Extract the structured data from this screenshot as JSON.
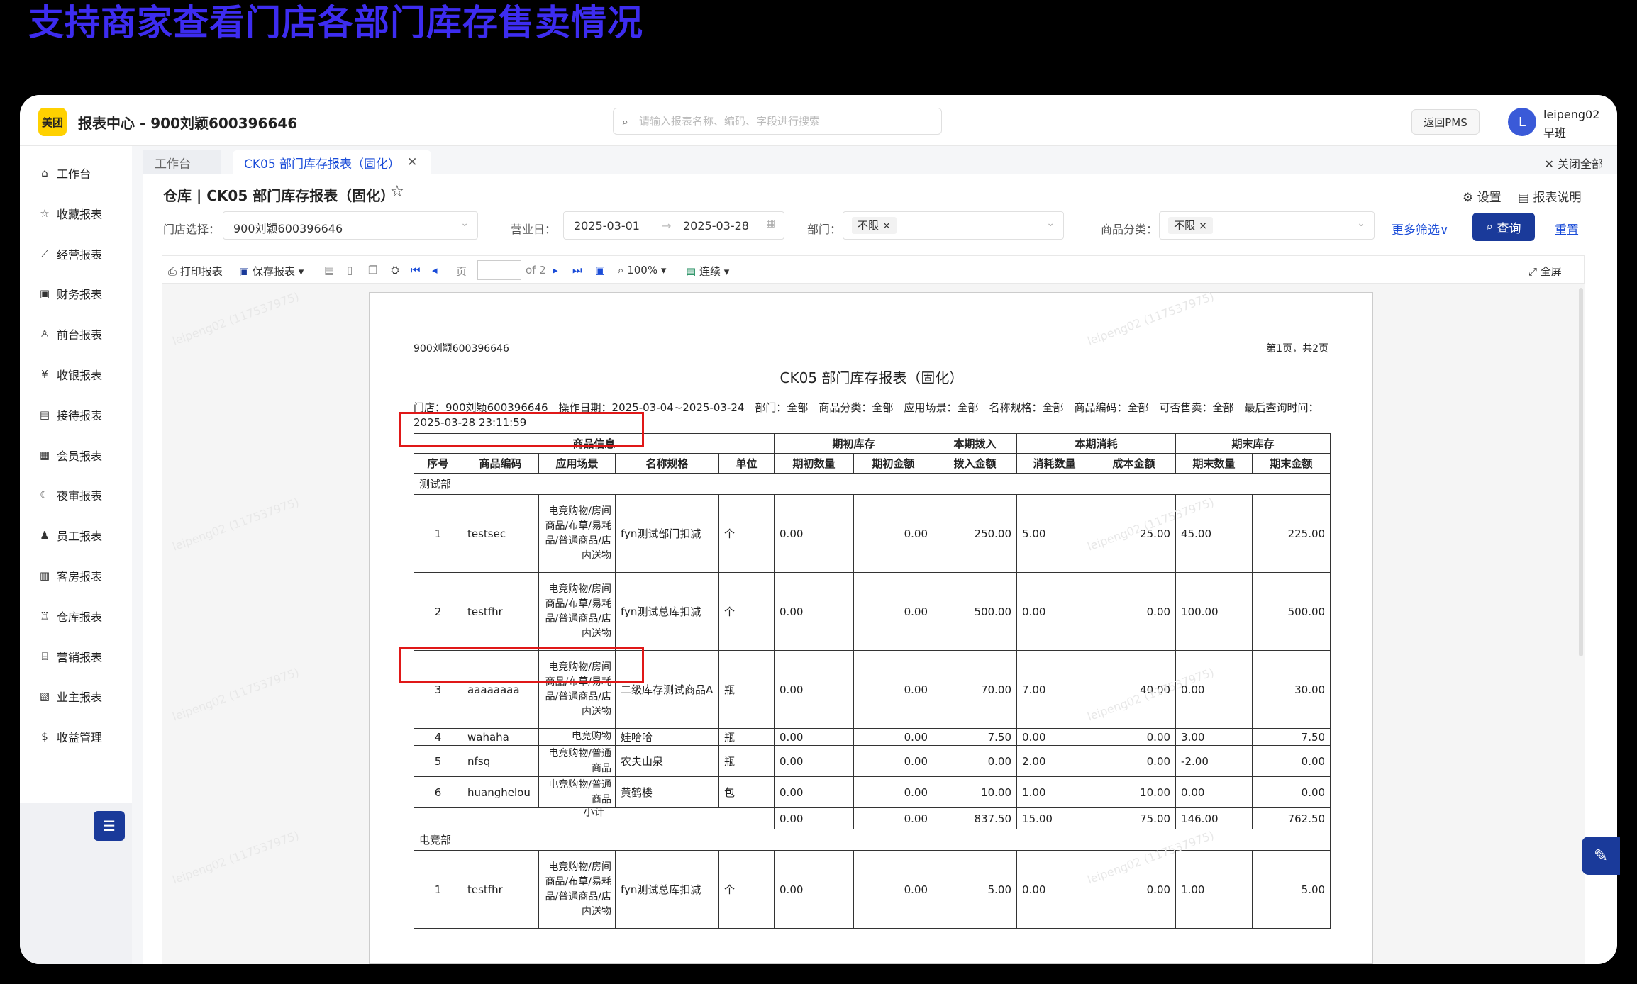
{
  "banner": "支持商家查看门店各部门库存售卖情况",
  "app": {
    "logo": "美团",
    "title": "报表中心 - 900刘颖600396646"
  },
  "search": {
    "placeholder": "请输入报表名称、编码、字段进行搜索",
    "icon": "search-icon"
  },
  "header": {
    "pms_label": "返回PMS",
    "avatar_letter": "L",
    "user_name": "leipeng02",
    "user_shift": "早班"
  },
  "sidebar": {
    "items": [
      {
        "label": "工作台",
        "icon": "⌂"
      },
      {
        "label": "收藏报表",
        "icon": "☆"
      },
      {
        "label": "经营报表",
        "icon": "⟋"
      },
      {
        "label": "财务报表",
        "icon": "▣"
      },
      {
        "label": "前台报表",
        "icon": "♙"
      },
      {
        "label": "收银报表",
        "icon": "¥"
      },
      {
        "label": "接待报表",
        "icon": "▤"
      },
      {
        "label": "会员报表",
        "icon": "▦"
      },
      {
        "label": "夜审报表",
        "icon": "☾"
      },
      {
        "label": "员工报表",
        "icon": "♟"
      },
      {
        "label": "客房报表",
        "icon": "▥"
      },
      {
        "label": "仓库报表",
        "icon": "♖"
      },
      {
        "label": "营销报表",
        "icon": "⌸"
      },
      {
        "label": "业主报表",
        "icon": "▧"
      },
      {
        "label": "收益管理",
        "icon": "$"
      }
    ]
  },
  "tabs": {
    "home": "工作台",
    "active": "CK05 部门库存报表（固化）",
    "close_all": "✕ 关闭全部"
  },
  "page": {
    "title": "仓库 | CK05 部门库存报表（固化）",
    "settings": "设置",
    "help": "报表说明"
  },
  "filters": {
    "store_label": "门店选择：",
    "store_value": "900刘颖600396646",
    "date_label": "营业日：",
    "date_from": "2025-03-01",
    "date_to": "2025-03-28",
    "dept_label": "部门：",
    "dept_tag": "不限",
    "cat_label": "商品分类：",
    "cat_tag": "不限",
    "more": "更多筛选",
    "query": "查询",
    "reset": "重置"
  },
  "toolbar": {
    "print": "打印报表",
    "save": "保存报表",
    "page_label": "页",
    "page_of": "of 2",
    "zoom": "100%",
    "mode": "连续",
    "fullscreen": "全屏"
  },
  "report": {
    "hdr_left": "900刘颖600396646",
    "hdr_right": "第1页，共2页",
    "title": "CK05 部门库存报表（固化）",
    "meta": "门店：900刘颖600396646　操作日期：2025-03-04~2025-03-24　部门：全部　商品分类：全部　应用场景：全部　名称规格：全部　商品编码：全部　可否售卖：全部　最后查询时间：2025-03-28 23:11:59",
    "group_headers": [
      "商品信息",
      "期初库存",
      "本期拨入",
      "本期消耗",
      "期末库存"
    ],
    "col_headers": [
      "序号",
      "商品编码",
      "应用场景",
      "名称规格",
      "单位",
      "期初数量",
      "期初金额",
      "拨入金额",
      "消耗数量",
      "成本金额",
      "期末数量",
      "期末金额"
    ],
    "dept1": "测试部",
    "rows1": [
      [
        "1",
        "testsec",
        "电竞购物/房间商品/布草/易耗品/普通商品/店内送物",
        "fyn测试部门扣减",
        "个",
        "0.00",
        "0.00",
        "250.00",
        "5.00",
        "25.00",
        "45.00",
        "225.00"
      ],
      [
        "2",
        "testfhr",
        "电竞购物/房间商品/布草/易耗品/普通商品/店内送物",
        "fyn测试总库扣减",
        "个",
        "0.00",
        "0.00",
        "500.00",
        "0.00",
        "0.00",
        "100.00",
        "500.00"
      ],
      [
        "3",
        "aaaaaaaa",
        "电竞购物/房间商品/布草/易耗品/普通商品/店内送物",
        "二级库存测试商品A",
        "瓶",
        "0.00",
        "0.00",
        "70.00",
        "7.00",
        "40.00",
        "0.00",
        "30.00"
      ],
      [
        "4",
        "wahaha",
        "电竞购物",
        "娃哈哈",
        "瓶",
        "0.00",
        "0.00",
        "7.50",
        "0.00",
        "0.00",
        "3.00",
        "7.50"
      ],
      [
        "5",
        "nfsq",
        "电竞购物/普通商品",
        "农夫山泉",
        "瓶",
        "0.00",
        "0.00",
        "0.00",
        "2.00",
        "0.00",
        "-2.00",
        "0.00"
      ],
      [
        "6",
        "huanghelou",
        "电竞购物/普通商品",
        "黄鹤楼",
        "包",
        "0.00",
        "0.00",
        "10.00",
        "1.00",
        "10.00",
        "0.00",
        "0.00"
      ]
    ],
    "subtotal_label": "小计",
    "subtotal": [
      "0.00",
      "0.00",
      "837.50",
      "15.00",
      "75.00",
      "146.00",
      "762.50"
    ],
    "dept2": "电竞部",
    "rows2": [
      [
        "1",
        "testfhr",
        "电竞购物/房间商品/布草/易耗品/普通商品/店内送物",
        "fyn测试总库扣减",
        "个",
        "0.00",
        "0.00",
        "5.00",
        "0.00",
        "0.00",
        "1.00",
        "5.00"
      ]
    ]
  },
  "watermark": "leipeng02 (117537975)",
  "colors": {
    "accent": "#1a3a9a",
    "link": "#1a4cd8",
    "highlight": "#e01818",
    "banner": "#3d2cf0",
    "brand": "#ffd100"
  }
}
